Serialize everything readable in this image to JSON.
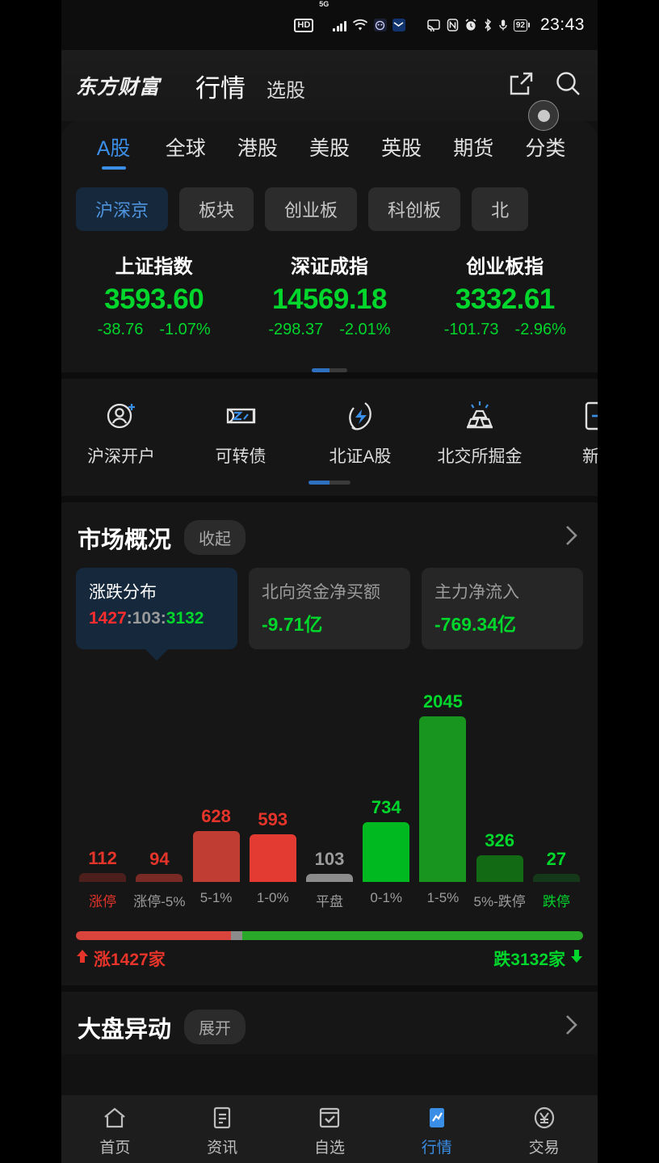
{
  "status_bar": {
    "hd": "HD",
    "network": "5G",
    "battery": "92",
    "time": "23:43",
    "icons": [
      "hd-icon",
      "5g-signal-icon",
      "wifi-icon",
      "app-badge-icon",
      "mail-icon",
      "cast-icon",
      "nfc-icon",
      "alarm-icon",
      "bluetooth-icon",
      "microphone-icon",
      "battery-icon"
    ]
  },
  "header": {
    "brand": "东方财富",
    "title": "行情",
    "secondary_title": "选股",
    "share_icon": "external-link-icon",
    "search_icon": "search-icon",
    "record_icon": "floating-record-button"
  },
  "tabs": [
    {
      "label": "A股",
      "active": true
    },
    {
      "label": "全球",
      "active": false
    },
    {
      "label": "港股",
      "active": false
    },
    {
      "label": "美股",
      "active": false
    },
    {
      "label": "英股",
      "active": false
    },
    {
      "label": "期货",
      "active": false
    },
    {
      "label": "分类",
      "active": false
    }
  ],
  "chips": [
    {
      "label": "沪深京",
      "active": true
    },
    {
      "label": "板块",
      "active": false
    },
    {
      "label": "创业板",
      "active": false
    },
    {
      "label": "科创板",
      "active": false
    },
    {
      "label": "北",
      "active": false
    }
  ],
  "indices": [
    {
      "name": "上证指数",
      "value": "3593.60",
      "change": "-38.76",
      "percent": "-1.07%"
    },
    {
      "name": "深证成指",
      "value": "14569.18",
      "change": "-298.37",
      "percent": "-2.01%"
    },
    {
      "name": "创业板指",
      "value": "3332.61",
      "change": "-101.73",
      "percent": "-2.96%"
    }
  ],
  "quick_actions": [
    {
      "label": "沪深开户",
      "icon": "add-user-icon"
    },
    {
      "label": "可转债",
      "icon": "convertible-bond-icon"
    },
    {
      "label": "北证A股",
      "icon": "lightning-icon"
    },
    {
      "label": "北交所掘金",
      "icon": "gold-bar-icon"
    },
    {
      "label": "新三",
      "icon": "board-icon"
    }
  ],
  "market_overview": {
    "title": "市场概况",
    "pill": "收起",
    "arrow_icon": "chevron-right-icon",
    "cards": [
      {
        "label": "涨跌分布",
        "up": "1427",
        "flat": "103",
        "down": "3132",
        "active": true
      },
      {
        "label": "北向资金净买额",
        "value": "-9.71亿",
        "active": false
      },
      {
        "label": "主力净流入",
        "value": "-769.34亿",
        "active": false
      }
    ]
  },
  "chart_data": {
    "type": "bar",
    "title": "涨跌分布",
    "categories": [
      "涨停",
      "涨停-5%",
      "5-1%",
      "1-0%",
      "平盘",
      "0-1%",
      "1-5%",
      "5%-跌停",
      "跌停"
    ],
    "values": [
      112,
      94,
      628,
      593,
      103,
      734,
      2045,
      326,
      27
    ],
    "colors": [
      "#4d1f1c",
      "#7a2a24",
      "#c03d33",
      "#e33b32",
      "#8c8c8c",
      "#00b81f",
      "#17951f",
      "#126b14",
      "#16381a"
    ],
    "label_colors": [
      "#e5342a",
      "#e5342a",
      "#e5342a",
      "#e5342a",
      "#9c9c9c",
      "#00d62b",
      "#00d62b",
      "#00d62b",
      "#00d62b"
    ],
    "tick_colors": [
      "#e5342a",
      "#9c9c9c",
      "#9c9c9c",
      "#9c9c9c",
      "#9c9c9c",
      "#9c9c9c",
      "#9c9c9c",
      "#9c9c9c",
      "#00d62b"
    ],
    "ylim": [
      0,
      2045
    ],
    "xlabel": "",
    "ylabel": "",
    "grid": false,
    "legend": "none"
  },
  "ratio": {
    "up_label": "涨1427家",
    "down_label": "跌3132家",
    "up_count": 1427,
    "flat_count": 103,
    "down_count": 3132,
    "up_arrow": "arrow-up-icon",
    "down_arrow": "arrow-down-icon"
  },
  "market_moves": {
    "title": "大盘异动",
    "pill": "展开",
    "arrow_icon": "chevron-right-icon"
  },
  "bottom_nav": [
    {
      "label": "首页",
      "icon": "home-icon",
      "active": false
    },
    {
      "label": "资讯",
      "icon": "news-icon",
      "active": false
    },
    {
      "label": "自选",
      "icon": "watchlist-icon",
      "active": false
    },
    {
      "label": "行情",
      "icon": "quotes-chart-icon",
      "active": true
    },
    {
      "label": "交易",
      "icon": "yuan-trade-icon",
      "active": true
    }
  ],
  "colors": {
    "accent": "#3a8ee6",
    "up_red": "#e5342a",
    "down_green": "#00d62b",
    "flat_gray": "#8c8c8c"
  }
}
